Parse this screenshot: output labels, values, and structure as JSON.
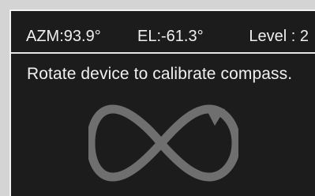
{
  "status": {
    "azimuth": "AZM:93.9°",
    "elevation": "EL:-61.3°",
    "level": "Level : 2"
  },
  "instruction": {
    "text": "Rotate device to calibrate compass."
  },
  "icons": {
    "calibration": "infinity-arrow-icon"
  },
  "colors": {
    "background": "#1c1c1c",
    "text": "#efefef",
    "accent": "#6f6f6f",
    "border": "#e6e6e6"
  }
}
